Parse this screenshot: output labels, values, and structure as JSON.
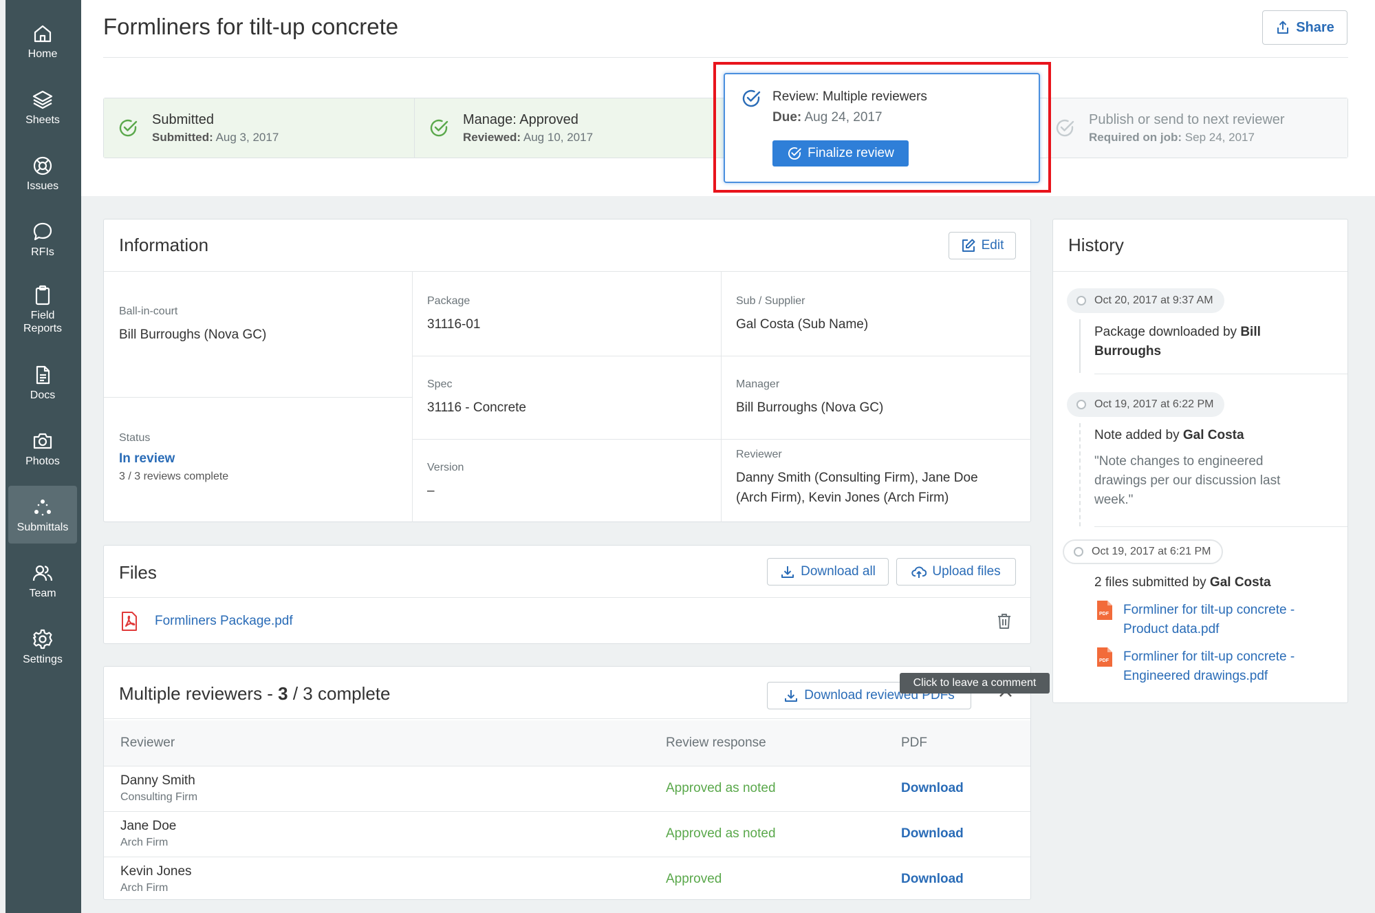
{
  "sidebar": {
    "items": [
      {
        "label": "Home"
      },
      {
        "label": "Sheets"
      },
      {
        "label": "Issues"
      },
      {
        "label": "RFIs"
      },
      {
        "label": "Field Reports"
      },
      {
        "label": "Docs"
      },
      {
        "label": "Photos"
      },
      {
        "label": "Submittals"
      },
      {
        "label": "Team"
      },
      {
        "label": "Settings"
      }
    ]
  },
  "header": {
    "title": "Formliners for tilt-up concrete",
    "share_label": "Share"
  },
  "steps": [
    {
      "title": "Submitted",
      "sub_label": "Submitted:",
      "sub_value": "Aug 3, 2017"
    },
    {
      "title": "Manage: Approved",
      "sub_label": "Reviewed:",
      "sub_value": "Aug 10, 2017"
    },
    {
      "title": "Review: Multiple reviewers",
      "sub_label": "Due:",
      "sub_value": "Aug 24, 2017",
      "button": "Finalize review"
    },
    {
      "title": "Publish or send to next reviewer",
      "sub_label": "Required on job:",
      "sub_value": "Sep 24, 2017"
    }
  ],
  "information": {
    "title": "Information",
    "edit_label": "Edit",
    "ball_in_court": {
      "label": "Ball-in-court",
      "value": "Bill Burroughs (Nova GC)"
    },
    "status": {
      "label": "Status",
      "value": "In review",
      "sub": "3 / 3 reviews complete"
    },
    "package": {
      "label": "Package",
      "value": "31116-01"
    },
    "sub_supplier": {
      "label": "Sub / Supplier",
      "value": "Gal Costa (Sub Name)"
    },
    "spec": {
      "label": "Spec",
      "value": "31116 - Concrete"
    },
    "manager": {
      "label": "Manager",
      "value": "Bill Burroughs (Nova GC)"
    },
    "version": {
      "label": "Version",
      "value": "–"
    },
    "reviewer": {
      "label": "Reviewer",
      "value": "Danny Smith (Consulting Firm), Jane Doe (Arch Firm), Kevin Jones (Arch Firm)"
    }
  },
  "files": {
    "title": "Files",
    "download_all": "Download all",
    "upload": "Upload files",
    "items": [
      {
        "name": "Formliners Package.pdf"
      }
    ]
  },
  "reviewers": {
    "title_prefix": "Multiple reviewers - ",
    "done": "3",
    "title_suffix": " / 3 complete",
    "download_label": "Download reviewed PDFs",
    "tooltip": "Click to leave a comment",
    "columns": [
      "Reviewer",
      "Review response",
      "PDF"
    ],
    "rows": [
      {
        "name": "Danny Smith",
        "org": "Consulting Firm",
        "response": "Approved as noted",
        "pdf": "Download"
      },
      {
        "name": "Jane Doe",
        "org": "Arch Firm",
        "response": "Approved as noted",
        "pdf": "Download"
      },
      {
        "name": "Kevin Jones",
        "org": "Arch Firm",
        "response": "Approved",
        "pdf": "Download"
      }
    ]
  },
  "history": {
    "title": "History",
    "entries": [
      {
        "time": "Oct 20, 2017 at 9:37 AM",
        "text": "Package downloaded by ",
        "who": "Bill Burroughs"
      },
      {
        "time": "Oct 19, 2017 at 6:22 PM",
        "text": "Note added by ",
        "who": "Gal Costa",
        "quote": "\"Note changes to engineered drawings per our discussion last week.\""
      },
      {
        "time": "Oct 19, 2017 at 6:21 PM",
        "text": "2 files submitted by ",
        "who": "Gal Costa",
        "files": [
          "Formliner for tilt-up concrete - Product data.pdf",
          "Formliner for tilt-up concrete - Engineered drawings.pdf"
        ]
      }
    ]
  },
  "colors": {
    "accent": "#2a6cb7",
    "primary_button": "#2f7fd8",
    "success": "#5aa84b",
    "sidebar": "#3f5258",
    "highlight": "#e8141c"
  }
}
